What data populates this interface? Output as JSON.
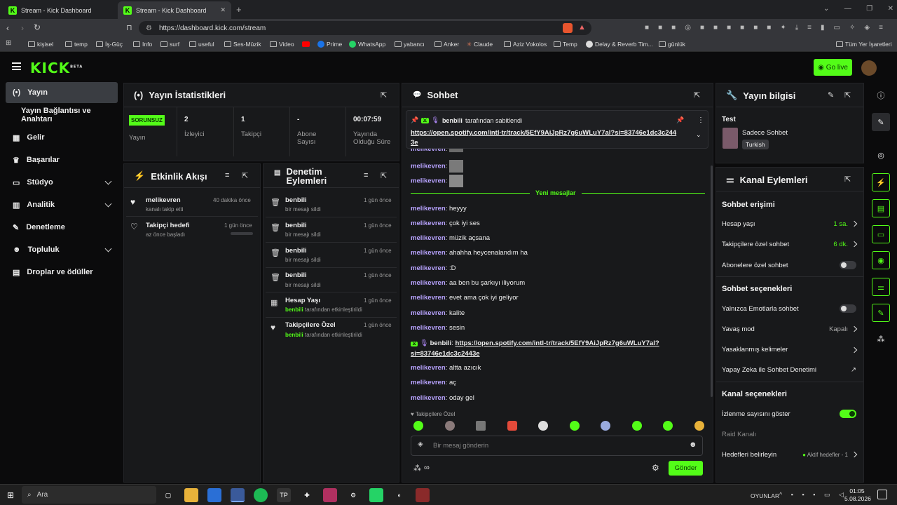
{
  "browser": {
    "tabs": [
      {
        "title": "Stream - Kick Dashboard"
      },
      {
        "title": "Stream - Kick Dashboard"
      }
    ],
    "url": "https://dashboard.kick.com/stream",
    "bookmarks": [
      "kişisel",
      "temp",
      "İş-Güç",
      "Info",
      "surf",
      "useful",
      "Ses-Müzik",
      "Video",
      "Prime",
      "WhatsApp",
      "yabancı",
      "Anker",
      "Claude",
      "Aziz Vokolos",
      "Temp",
      "Delay & Reverb Tim...",
      "günlük"
    ],
    "all_bookmarks": "Tüm Yer İşaretleri"
  },
  "app": {
    "logo": "KICK",
    "beta": "BETA",
    "go_live": "Go live"
  },
  "nav": [
    {
      "label": "Yayın",
      "icon": "broadcast-icon"
    },
    {
      "label": "Yayın Bağlantısı ve Anahtarı"
    },
    {
      "label": "Gelir",
      "icon": "chart-icon"
    },
    {
      "label": "Başarılar",
      "icon": "trophy-icon"
    },
    {
      "label": "Stüdyo",
      "icon": "studio-icon"
    },
    {
      "label": "Analitik",
      "icon": "analytics-icon"
    },
    {
      "label": "Denetleme",
      "icon": "wrench-icon"
    },
    {
      "label": "Topluluk",
      "icon": "community-icon"
    },
    {
      "label": "Droplar ve ödüller",
      "icon": "drops-icon"
    }
  ],
  "stats": {
    "title": "Yayın İstatistikleri",
    "badge": "SORUNSUZ",
    "badge_label": "Yayın",
    "items": [
      {
        "value": "2",
        "label": "İzleyici"
      },
      {
        "value": "1",
        "label": "Takipçi"
      },
      {
        "value": "-",
        "label": "Abone Sayısı"
      },
      {
        "value": "00:07:59",
        "label": "Yayında Olduğu Süre"
      }
    ]
  },
  "activity": {
    "title": "Etkinlik Akışı",
    "items": [
      {
        "title": "melikevren",
        "sub": "kanalı takip etti",
        "time": "40 dakika önce"
      },
      {
        "title": "Takipçi hedefi",
        "sub": "az önce başladı",
        "time": "1 gün önce"
      }
    ]
  },
  "moderation": {
    "title": "Denetim Eylemleri",
    "items": [
      {
        "title": "benbili",
        "sub": "bir mesajı sildi",
        "time": "1 gün önce"
      },
      {
        "title": "benbili",
        "sub": "bir mesajı sildi",
        "time": "1 gün önce"
      },
      {
        "title": "benbili",
        "sub": "bir mesajı sildi",
        "time": "1 gün önce"
      },
      {
        "title": "benbili",
        "sub": "bir mesajı sildi",
        "time": "1 gün önce"
      },
      {
        "title": "Hesap Yaşı",
        "sub_user": "benbili",
        "sub": "tarafından etkinleştirildi",
        "time": "1 gün önce"
      },
      {
        "title": "Takipçilere Özel",
        "sub_user": "benbili",
        "sub": "tarafından etkinleştirildi",
        "time": "1 gün önce"
      }
    ]
  },
  "chat": {
    "title": "Sohbet",
    "pinned_by": "benbili",
    "pinned_suffix": "tarafından sabitlendi",
    "pinned_link": "https://open.spotify.com/intl-tr/track/5EfY9AiJpRz7g6uWLuY7al?si=83746e1dc3c2443e",
    "new_messages": "Yeni mesajlar",
    "image_msgs": [
      {
        "user": "melikevren"
      },
      {
        "user": "melikevren"
      },
      {
        "user": "melikevren"
      }
    ],
    "messages": [
      {
        "user": "melikevren",
        "text": "heyyy"
      },
      {
        "user": "melikevren",
        "text": "çok iyi ses"
      },
      {
        "user": "melikevren",
        "text": "müzik açsana"
      },
      {
        "user": "melikevren",
        "text": "ahahha heycenalandım ha"
      },
      {
        "user": "melikevren",
        "text": ":D"
      },
      {
        "user": "melikevren",
        "text": "aa ben bu şarkıyı iliyorum"
      },
      {
        "user": "melikevren",
        "text": "evet ama çok iyi geliyor"
      },
      {
        "user": "melikevren",
        "text": "kalite"
      },
      {
        "user": "melikevren",
        "text": "sesin"
      }
    ],
    "link_msg": {
      "user": "benbili",
      "line1": "https://open.spotify.com/intl-tr/track/5EfY9AiJpRz7g6uWLuY7al?",
      "line2": "si=83746e1dc3c2443e"
    },
    "messages2": [
      {
        "user": "melikevren",
        "text": "altta azıcık"
      },
      {
        "user": "melikevren",
        "text": "aç"
      },
      {
        "user": "melikevren",
        "text": "oday gel"
      }
    ],
    "mode": "Takipçilere Özel",
    "placeholder": "Bir mesaj gönderin",
    "send": "Gönder"
  },
  "info": {
    "title": "Yayın bilgisi",
    "stream_title": "Test",
    "category": "Sadece Sohbet",
    "tag": "Turkish"
  },
  "actions": {
    "title": "Kanal Eylemleri",
    "chat_access": "Sohbet erişimi",
    "account_age": {
      "label": "Hesap yaşı",
      "value": "1 sa."
    },
    "followers_only": {
      "label": "Takipçilere özel sohbet",
      "value": "6 dk."
    },
    "subs_only": "Abonelere özel sohbet",
    "chat_options": "Sohbet seçenekleri",
    "emote_only": "Yalnızca Emotlarla sohbet",
    "slow": {
      "label": "Yavaş mod",
      "value": "Kapalı"
    },
    "banned_words": "Yasaklanmış kelimeler",
    "ai_mod": "Yapay Zeka ile Sohbet Denetimi",
    "channel_options": "Kanal seçenekleri",
    "show_views": "İzlenme sayısını göster",
    "raid": "Raid Kanalı",
    "goals": {
      "label": "Hedefleri belirleyin",
      "value": "Aktif hedefler - 1"
    }
  },
  "taskbar": {
    "search": "Ara",
    "tray_label": "OYUNLAR",
    "time": "01:05",
    "date": "5.08.2026"
  }
}
